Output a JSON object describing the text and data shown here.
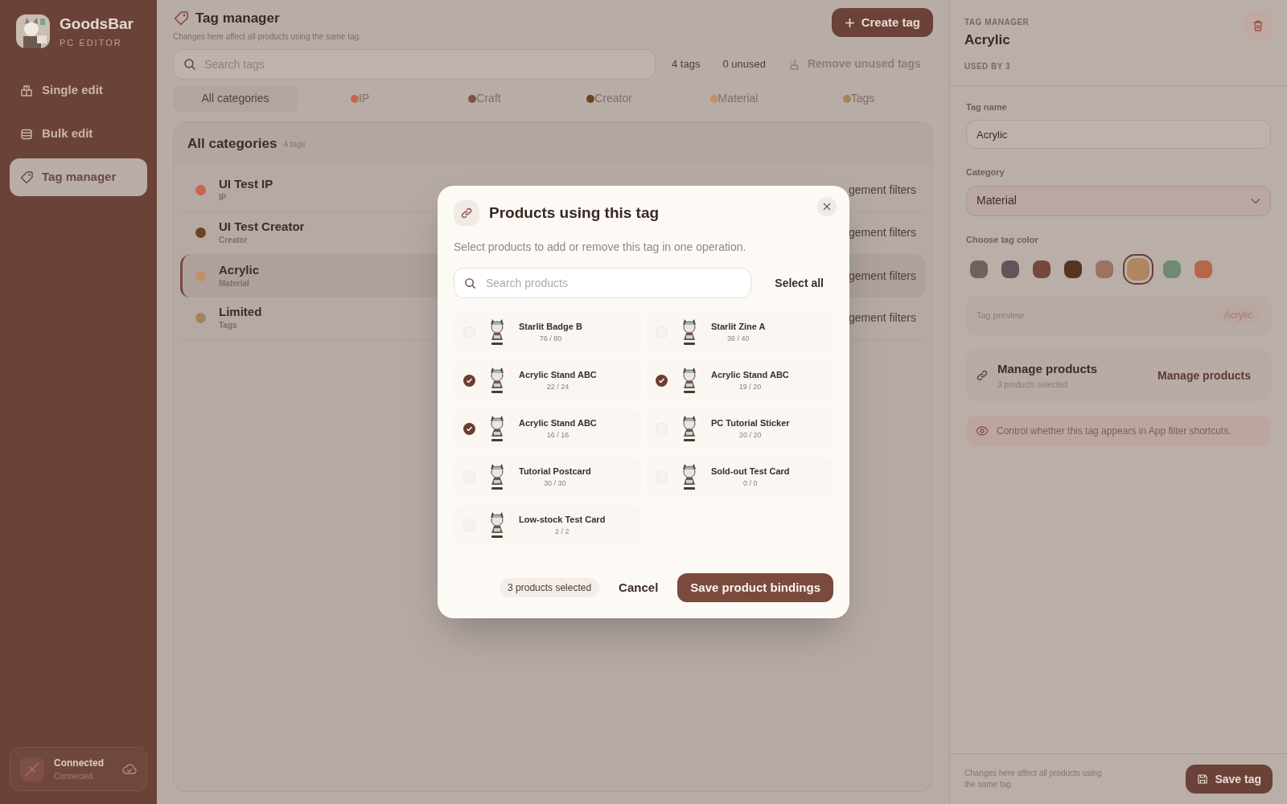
{
  "app": {
    "name": "GoodsBar",
    "subtitle": "PC EDITOR"
  },
  "nav": [
    {
      "label": "Single edit",
      "kind": "box",
      "selected": false
    },
    {
      "label": "Bulk edit",
      "kind": "table",
      "selected": false
    },
    {
      "label": "Tag manager",
      "kind": "tag",
      "selected": true
    }
  ],
  "connection": {
    "title": "Connected",
    "subtitle": "Connected"
  },
  "header": {
    "title": "Tag manager",
    "subtitle": "Changes here affect all products using the same tag.",
    "create_button": "Create tag"
  },
  "search": {
    "placeholder": "Search tags"
  },
  "stats": [
    "4 tags",
    "0 unused"
  ],
  "remove_button": "Remove unused tags",
  "category_tabs": [
    {
      "label": "All categories",
      "selected": true
    },
    {
      "label": "IP",
      "color": "#c8654f",
      "selected": false
    },
    {
      "label": "Craft",
      "color": "#7a5246",
      "selected": false
    },
    {
      "label": "Creator",
      "color": "#6b4222",
      "selected": false
    },
    {
      "label": "Material",
      "color": "#c0906a",
      "selected": false
    },
    {
      "label": "Tags",
      "color": "#a3835f",
      "selected": false
    }
  ],
  "list": {
    "title": "All categories",
    "count": "4 tags",
    "rows": [
      {
        "name": "UI Test IP",
        "category": "IP",
        "color": "#c8654f",
        "selected": false,
        "trailing": "gement filters"
      },
      {
        "name": "UI Test Creator",
        "category": "Creator",
        "color": "#6b4222",
        "selected": false,
        "trailing": "gement filters"
      },
      {
        "name": "Acrylic",
        "category": "Material",
        "color": "#c0906a",
        "selected": true,
        "trailing": "gement filters"
      },
      {
        "name": "Limited",
        "category": "Tags",
        "color": "#a3835f",
        "selected": false,
        "trailing": "gement filters"
      }
    ]
  },
  "detail": {
    "kicker": "TAG MANAGER",
    "title": "Acrylic",
    "usage": "USED BY 3",
    "name_label": "Tag name",
    "name_value": "Acrylic",
    "category_label": "Category",
    "category_value": "Material",
    "color_label": "Choose tag color",
    "swatches": [
      {
        "color": "#735f61",
        "selected": false
      },
      {
        "color": "#65535a",
        "selected": false
      },
      {
        "color": "#77463c",
        "selected": false
      },
      {
        "color": "#553520",
        "selected": false
      },
      {
        "color": "#9c7262",
        "selected": false
      },
      {
        "color": "#b08560",
        "selected": true
      },
      {
        "color": "#6e8a70",
        "selected": false
      },
      {
        "color": "#b8654e",
        "selected": false
      }
    ],
    "preview_label": "Tag preview",
    "preview_chip": "Acrylic",
    "manage_title": "Manage products",
    "manage_subtitle": "3 products selected",
    "manage_button": "Manage products",
    "visibility_note": "Control whether this tag appears in App filter shortcuts.",
    "footer_note": "Changes here affect all products using the same tag.",
    "save_button": "Save tag"
  },
  "modal": {
    "title": "Products using this tag",
    "description": "Select products to add or remove this tag in one operation.",
    "search_placeholder": "Search products",
    "select_all": "Select all",
    "products": [
      {
        "name": "Starlit Badge B",
        "stock": "76 / 80",
        "checked": false
      },
      {
        "name": "Starlit Zine A",
        "stock": "36 / 40",
        "checked": false
      },
      {
        "name": "Acrylic Stand ABC",
        "stock": "22 / 24",
        "checked": true
      },
      {
        "name": "Acrylic Stand ABC",
        "stock": "19 / 20",
        "checked": true
      },
      {
        "name": "Acrylic Stand ABC",
        "stock": "16 / 16",
        "checked": true
      },
      {
        "name": "PC Tutorial Sticker",
        "stock": "20 / 20",
        "checked": false
      },
      {
        "name": "Tutorial Postcard",
        "stock": "30 / 30",
        "checked": false
      },
      {
        "name": "Sold-out Test Card",
        "stock": "0 / 0",
        "checked": false
      },
      {
        "name": "Low-stock Test Card",
        "stock": "2 / 2",
        "checked": false
      }
    ],
    "selected_count": "3 products selected",
    "cancel": "Cancel",
    "save": "Save product bindings"
  }
}
